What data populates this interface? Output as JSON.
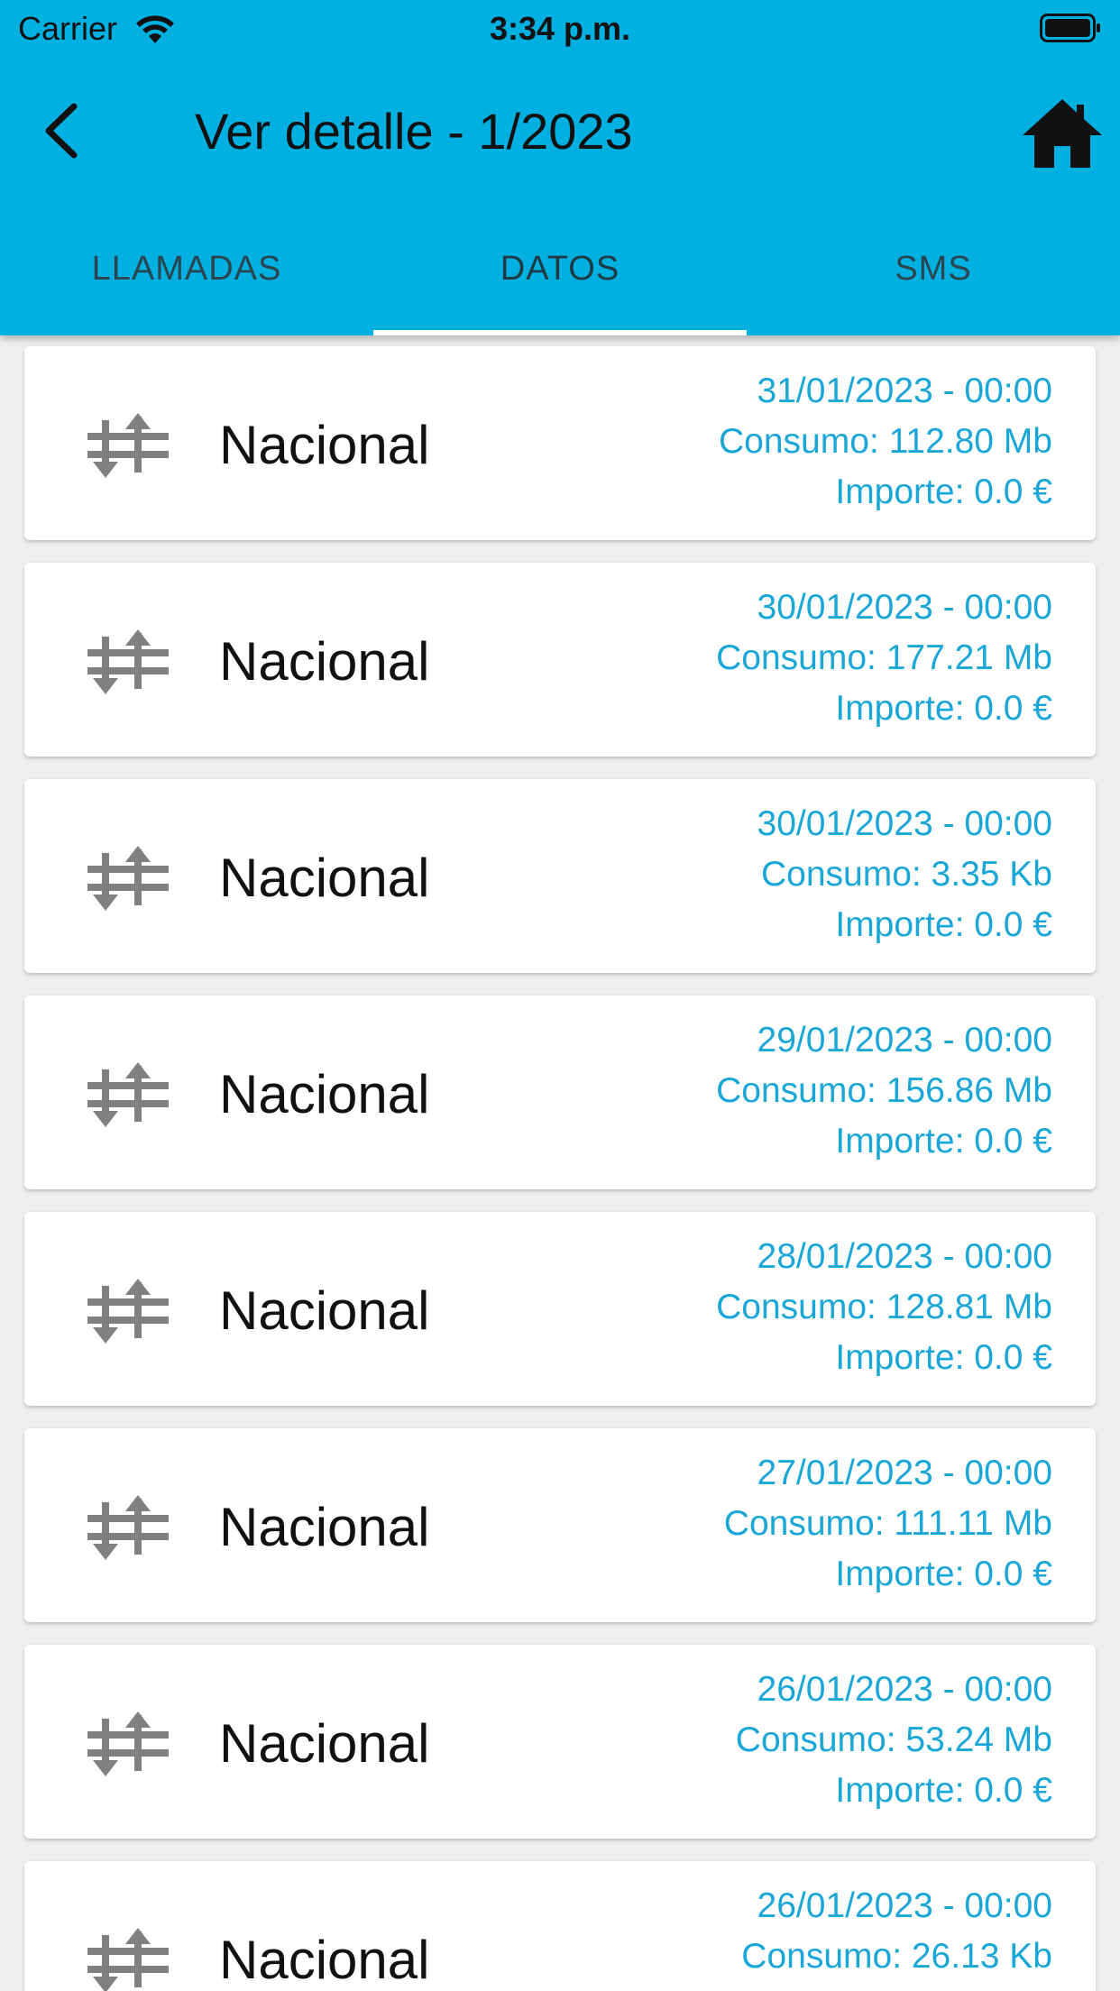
{
  "status_bar": {
    "carrier": "Carrier",
    "time": "3:34 p.m."
  },
  "header": {
    "title": "Ver detalle - 1/2023",
    "back_icon": "chevron-left-icon",
    "home_icon": "home-icon"
  },
  "tabs": [
    {
      "label": "LLAMADAS",
      "active": false
    },
    {
      "label": "DATOS",
      "active": true
    },
    {
      "label": "SMS",
      "active": false
    }
  ],
  "colors": {
    "accent": "#00b0e0",
    "info_text": "#1aa6d6",
    "icon": "#808080"
  },
  "items": [
    {
      "label": "Nacional",
      "date": "31/01/2023 - 00:00",
      "consumo": "Consumo: 112.80 Mb",
      "importe": "Importe: 0.0 €"
    },
    {
      "label": "Nacional",
      "date": "30/01/2023 - 00:00",
      "consumo": "Consumo: 177.21 Mb",
      "importe": "Importe: 0.0 €"
    },
    {
      "label": "Nacional",
      "date": "30/01/2023 - 00:00",
      "consumo": "Consumo: 3.35 Kb",
      "importe": "Importe: 0.0 €"
    },
    {
      "label": "Nacional",
      "date": "29/01/2023 - 00:00",
      "consumo": "Consumo: 156.86 Mb",
      "importe": "Importe: 0.0 €"
    },
    {
      "label": "Nacional",
      "date": "28/01/2023 - 00:00",
      "consumo": "Consumo: 128.81 Mb",
      "importe": "Importe: 0.0 €"
    },
    {
      "label": "Nacional",
      "date": "27/01/2023 - 00:00",
      "consumo": "Consumo: 111.11 Mb",
      "importe": "Importe: 0.0 €"
    },
    {
      "label": "Nacional",
      "date": "26/01/2023 - 00:00",
      "consumo": "Consumo: 53.24 Mb",
      "importe": "Importe: 0.0 €"
    },
    {
      "label": "Nacional",
      "date": "26/01/2023 - 00:00",
      "consumo": "Consumo: 26.13 Kb",
      "importe": ""
    }
  ]
}
